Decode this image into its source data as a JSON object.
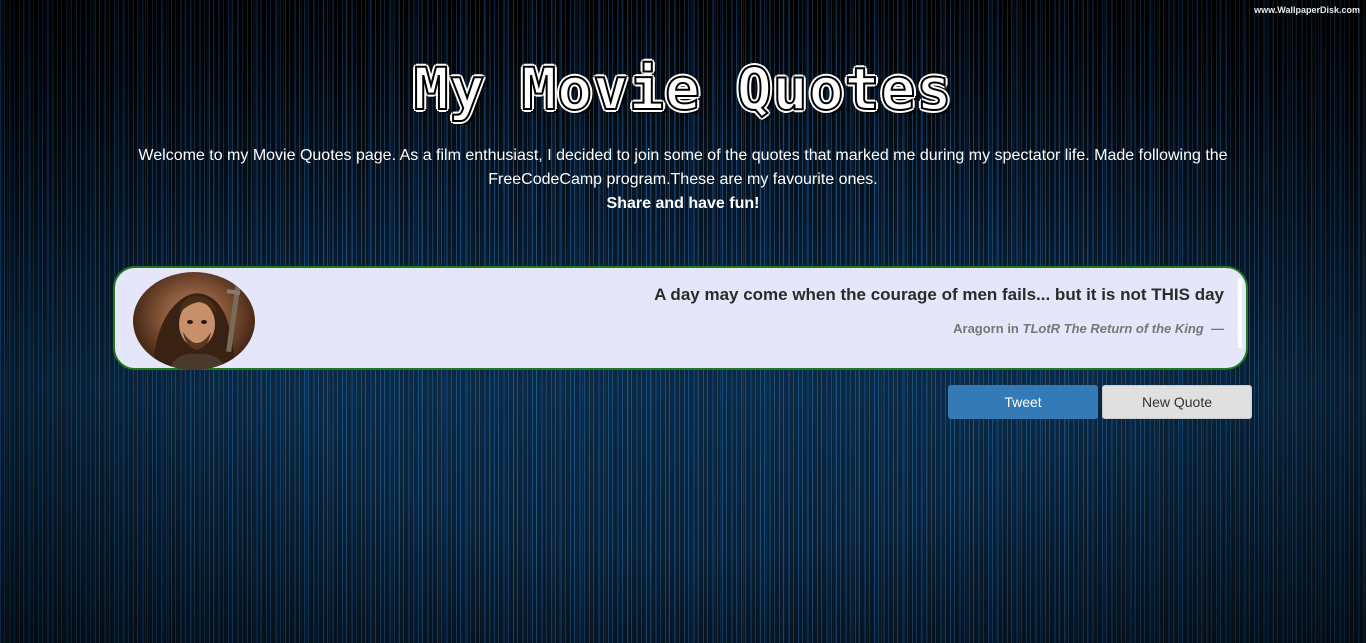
{
  "watermark": "www.WallpaperDisk.com",
  "header": {
    "title": "My Movie Quotes",
    "intro": "Welcome to my Movie Quotes page. As a film enthusiast, I decided to join some of the quotes that marked me during my spectator life. Made following the FreeCodeCamp program.These are my favourite ones.",
    "tagline": "Share and have fun!"
  },
  "quote": {
    "text": "A day may come when the courage of men fails... but it is not THIS day",
    "character": "Aragorn",
    "connector": "in",
    "movie": "TLotR The Return of the King",
    "dash": "—"
  },
  "buttons": {
    "tweet_label": "Tweet",
    "new_quote_label": "New Quote"
  },
  "colors": {
    "card_background": "#e6e6fa",
    "card_border": "#1e7a1e",
    "tweet_button": "#337ab7",
    "new_quote_button": "#e0e0e0"
  },
  "icons": {
    "avatar": "character-portrait"
  }
}
